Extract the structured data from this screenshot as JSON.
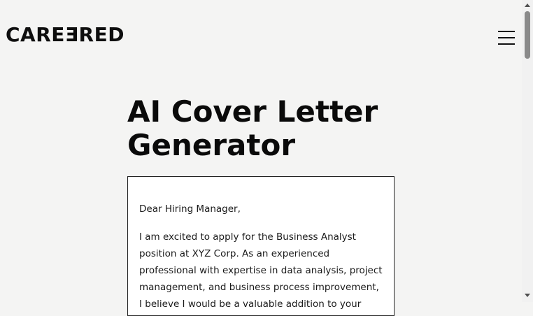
{
  "header": {
    "logo_prefix": "CARE",
    "logo_flipped": "E",
    "logo_suffix": "RED",
    "menu_icon": "hamburger-menu-icon"
  },
  "main": {
    "title": "AI Cover Letter Generator",
    "letter": {
      "greeting": "Dear Hiring Manager,",
      "paragraph_1": "I am excited to apply for the Business Analyst position at XYZ Corp. As an experienced professional with expertise in data analysis, project management, and business process improvement, I believe I would be a valuable addition to your team."
    }
  },
  "colors": {
    "page_background": "#f4f4f3",
    "letter_background": "#ffffff",
    "text": "#111111"
  }
}
